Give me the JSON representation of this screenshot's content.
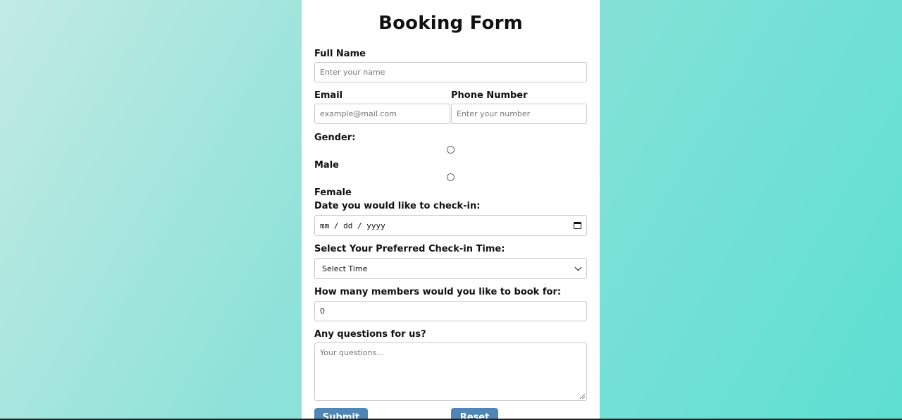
{
  "form": {
    "title": "Booking Form",
    "full_name": {
      "label": "Full Name",
      "placeholder": "Enter your name"
    },
    "email": {
      "label": "Email",
      "placeholder": "example@mail.com"
    },
    "phone": {
      "label": "Phone Number",
      "placeholder": "Enter your number"
    },
    "gender": {
      "label": "Gender:",
      "options": [
        "Male",
        "Female"
      ]
    },
    "checkin_date": {
      "label": "Date you would like to check-in:",
      "value": "mm / dd / yyyy"
    },
    "checkin_time": {
      "label": "Select Your Preferred Check-in Time:",
      "selected": "Select Time"
    },
    "members": {
      "label": "How many members would you like to book for:",
      "value": "0"
    },
    "questions": {
      "label": "Any questions for us?",
      "placeholder": "Your questions..."
    },
    "submit_label": "Submit",
    "reset_label": "Reset"
  },
  "colors": {
    "button": "#4f86b7",
    "background_start": "#c2ebe4",
    "background_end": "#5ddfd2"
  }
}
